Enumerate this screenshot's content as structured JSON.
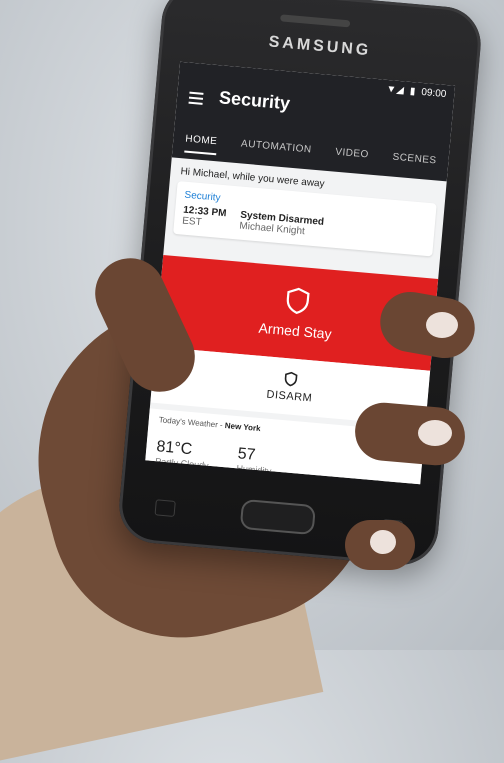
{
  "device": {
    "brand": "SAMSUNG"
  },
  "status_bar": {
    "time": "09:00"
  },
  "app": {
    "title": "Security"
  },
  "tabs": [
    {
      "label": "HOME",
      "active": true
    },
    {
      "label": "AUTOMATION",
      "active": false
    },
    {
      "label": "VIDEO",
      "active": false
    },
    {
      "label": "SCENES",
      "active": false
    }
  ],
  "greeting": "Hi Michael, while you were away",
  "activity": {
    "section": "Security",
    "time": "12:33 PM",
    "timezone": "EST",
    "event": "System Disarmed",
    "user": "Michael Knight"
  },
  "arm_status": {
    "label": "Armed Stay",
    "color": "#e02020"
  },
  "disarm": {
    "label": "DISARM"
  },
  "weather": {
    "heading": "Today's Weather - ",
    "location": "New York",
    "temperature": "81°C",
    "condition": "Partly Cloudy",
    "humidity_value": "57",
    "humidity_label": "Humidity",
    "icon": "sun-icon",
    "icon_color": "#f5a623"
  },
  "colors": {
    "accent_blue": "#1f80d6",
    "appbar": "#212226"
  }
}
